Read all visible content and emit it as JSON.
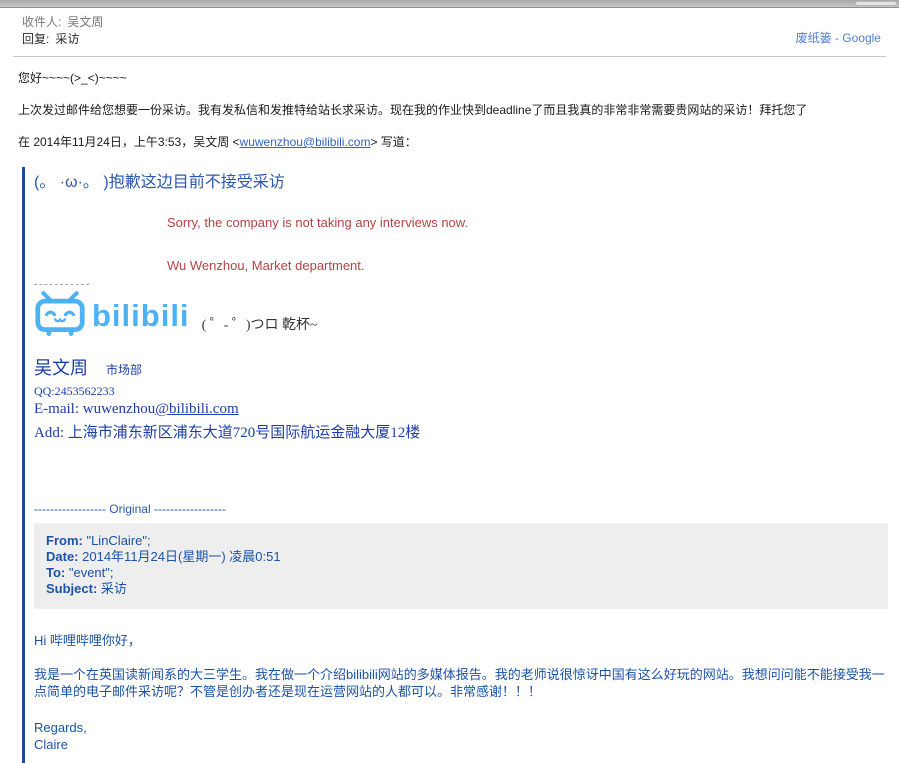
{
  "header": {
    "to_label": "收件人:",
    "to_value": "吴文周",
    "reply_label": "回复:",
    "reply_value": "采访",
    "trash_link": "废纸篓 - Google"
  },
  "message": {
    "greeting": "您好~~~~(>_<)~~~~",
    "body": "上次发过邮件给您想要一份采访。我有发私信和发推特给站长求采访。现在我的作业快到deadline了而且我真的非常非常需要贵网站的采访！拜托您了",
    "quote_intro_prefix": "在 2014年11月24日，上午3:53，吴文周 <",
    "quote_intro_email": "wuwenzhou@bilibili.com",
    "quote_intro_suffix": "> 写道："
  },
  "quoted": {
    "headline": "(。 ·ω·。 )抱歉这边目前不接受采访",
    "red_line1": "Sorry, the company is not taking any interviews now.",
    "red_line2": "Wu Wenzhou, Market department.",
    "logo_text": "bilibili",
    "logo_slogan": "( ゜- ゜)つロ 乾杯~",
    "signature": {
      "name": "吴文周",
      "dept": "市场部",
      "qq": "QQ:2453562233",
      "email_prefix": "E-mail: wuwenzhou",
      "email_link": "@bilibili.com",
      "address": "Add: 上海市浦东新区浦东大道720号国际航运金融大厦12楼"
    },
    "original_separator": "------------------ Original ------------------",
    "original_header": {
      "from_label": "From:",
      "from_value": " \"LinClaire\";",
      "date_label": "Date:",
      "date_value": " 2014年11月24日(星期一) 凌晨0:51",
      "to_label": "To:",
      "to_value": " \"event\";",
      "subject_label": "Subject:",
      "subject_value": " 采访"
    },
    "original_body": {
      "greeting": "Hi 哔哩哔哩你好，",
      "paragraph": "我是一个在英国读新闻系的大三学生。我在做一个介绍bilibili网站的多媒体报告。我的老师说很惊讶中国有这么好玩的网站。我想问问能不能接受我一点简单的电子邮件采访呢？不管是创办者还是现在运营网站的人都可以。非常感谢！！！",
      "regards": "Regards,",
      "name": "Claire"
    }
  },
  "colors": {
    "accent_blue": "#1c4a99",
    "link_blue": "#2f66c4",
    "logo_blue": "#4db2f2",
    "signature_blue": "#1c3ea8",
    "reply_red": "#b24444",
    "original_box_bg": "#eeeeee"
  }
}
